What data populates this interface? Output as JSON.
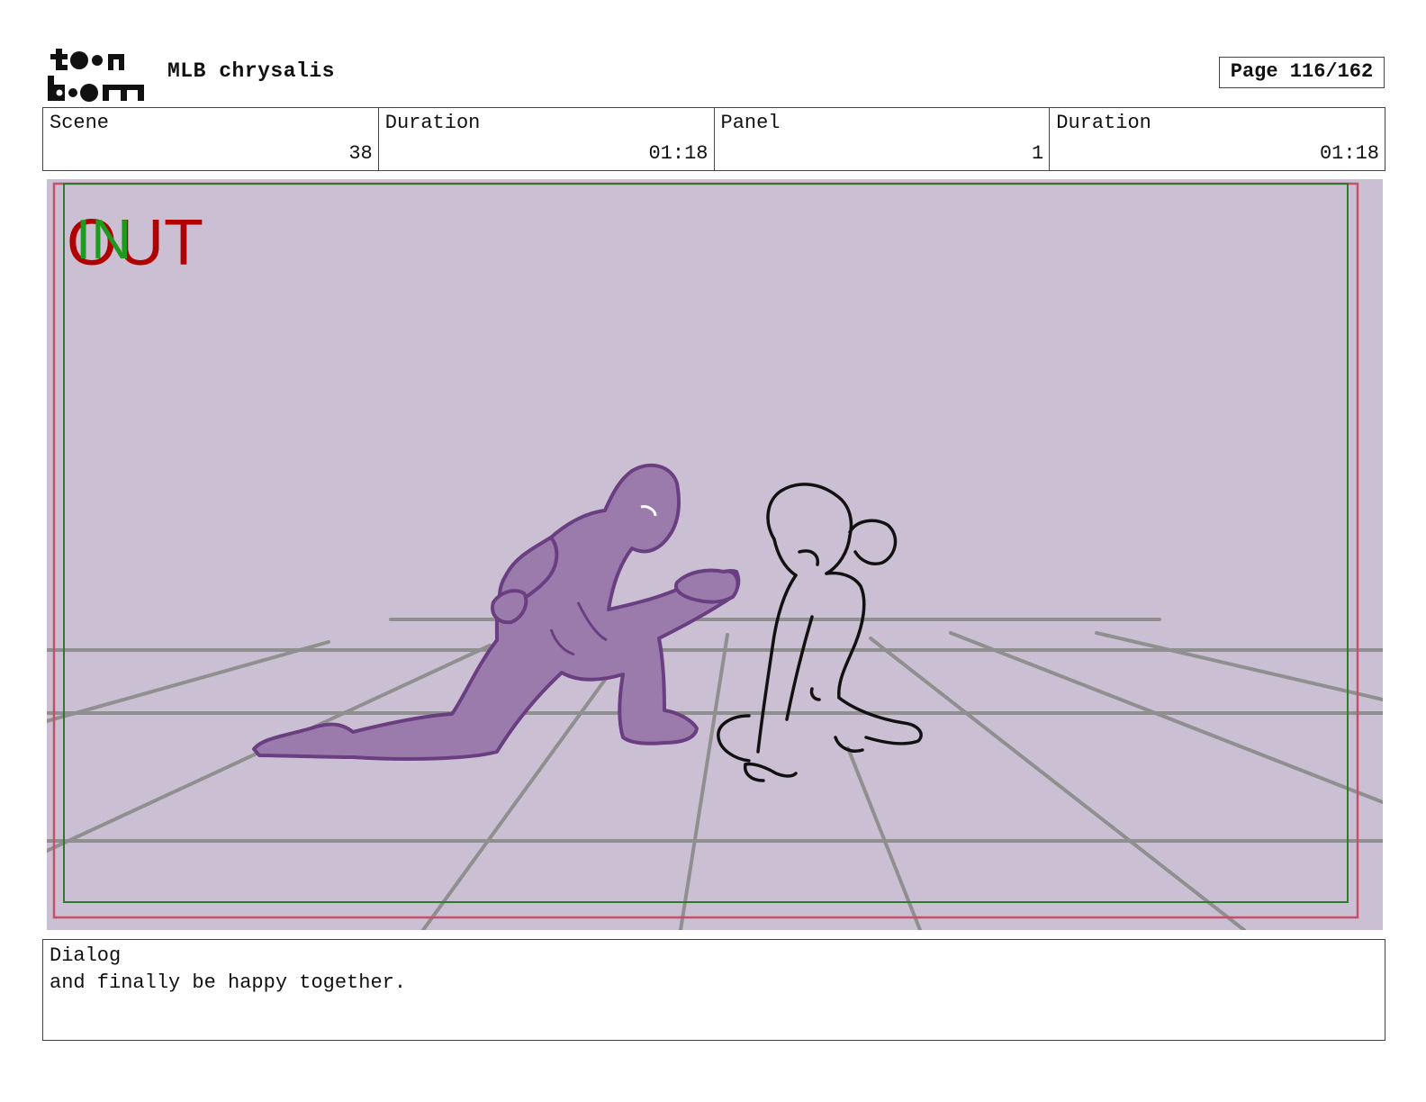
{
  "header": {
    "logo_text": "toon boom",
    "project_title": "MLB chrysalis",
    "page_indicator": "Page 116/162"
  },
  "info": {
    "scene_label": "Scene",
    "scene_value": "38",
    "duration_label": "Duration",
    "duration_value": "01:18",
    "panel_label": "Panel",
    "panel_value": "1",
    "panel_duration_label": "Duration",
    "panel_duration_value": "01:18"
  },
  "panel": {
    "in_marker": "IN",
    "out_marker": "OUT",
    "colors": {
      "background": "#cbbfd3",
      "in_marker": "#1e9a1e",
      "out_marker": "#b00000",
      "figure_fill": "#9b7bab",
      "figure_stroke": "#6a3f82",
      "grid": "#8f8f8f"
    }
  },
  "dialog": {
    "label": "Dialog",
    "text": "and finally be happy together."
  }
}
